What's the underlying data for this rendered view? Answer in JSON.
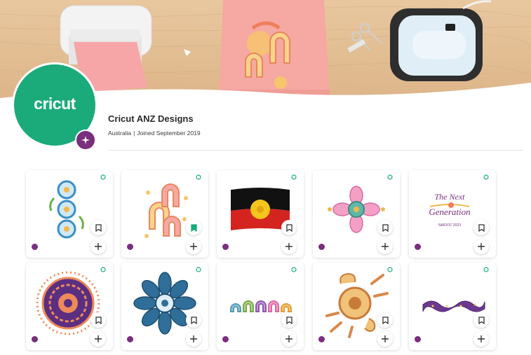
{
  "brand": {
    "logo_text": "cricut",
    "accent": "#1bab7b",
    "badge_color": "#7a2e7e"
  },
  "profile": {
    "name": "Cricut ANZ Designs",
    "location": "Australia",
    "separator": "|",
    "joined": "Joined September 2019"
  },
  "banner": {
    "icons": [
      "printer-icon",
      "sweatshirt-icon",
      "scissors-icon",
      "heat-press-icon"
    ]
  },
  "projects": [
    {
      "art": "circles-vertical",
      "saved": false
    },
    {
      "art": "u-shapes-pink",
      "saved": true
    },
    {
      "art": "aboriginal-flag",
      "saved": false
    },
    {
      "art": "pink-flower",
      "saved": false
    },
    {
      "art": "the-next-generation",
      "saved": false,
      "art_text": [
        "The Next",
        "Generation",
        "NAIDOC 2023"
      ]
    },
    {
      "art": "purple-mandala",
      "saved": false
    },
    {
      "art": "blue-flower",
      "saved": false
    },
    {
      "art": "colored-arches",
      "saved": false
    },
    {
      "art": "orange-sun",
      "saved": false
    },
    {
      "art": "purple-ribbon",
      "saved": false
    }
  ],
  "colors": {
    "saved_bookmark": "#1bab7b",
    "divider": "#e3e3e3"
  }
}
